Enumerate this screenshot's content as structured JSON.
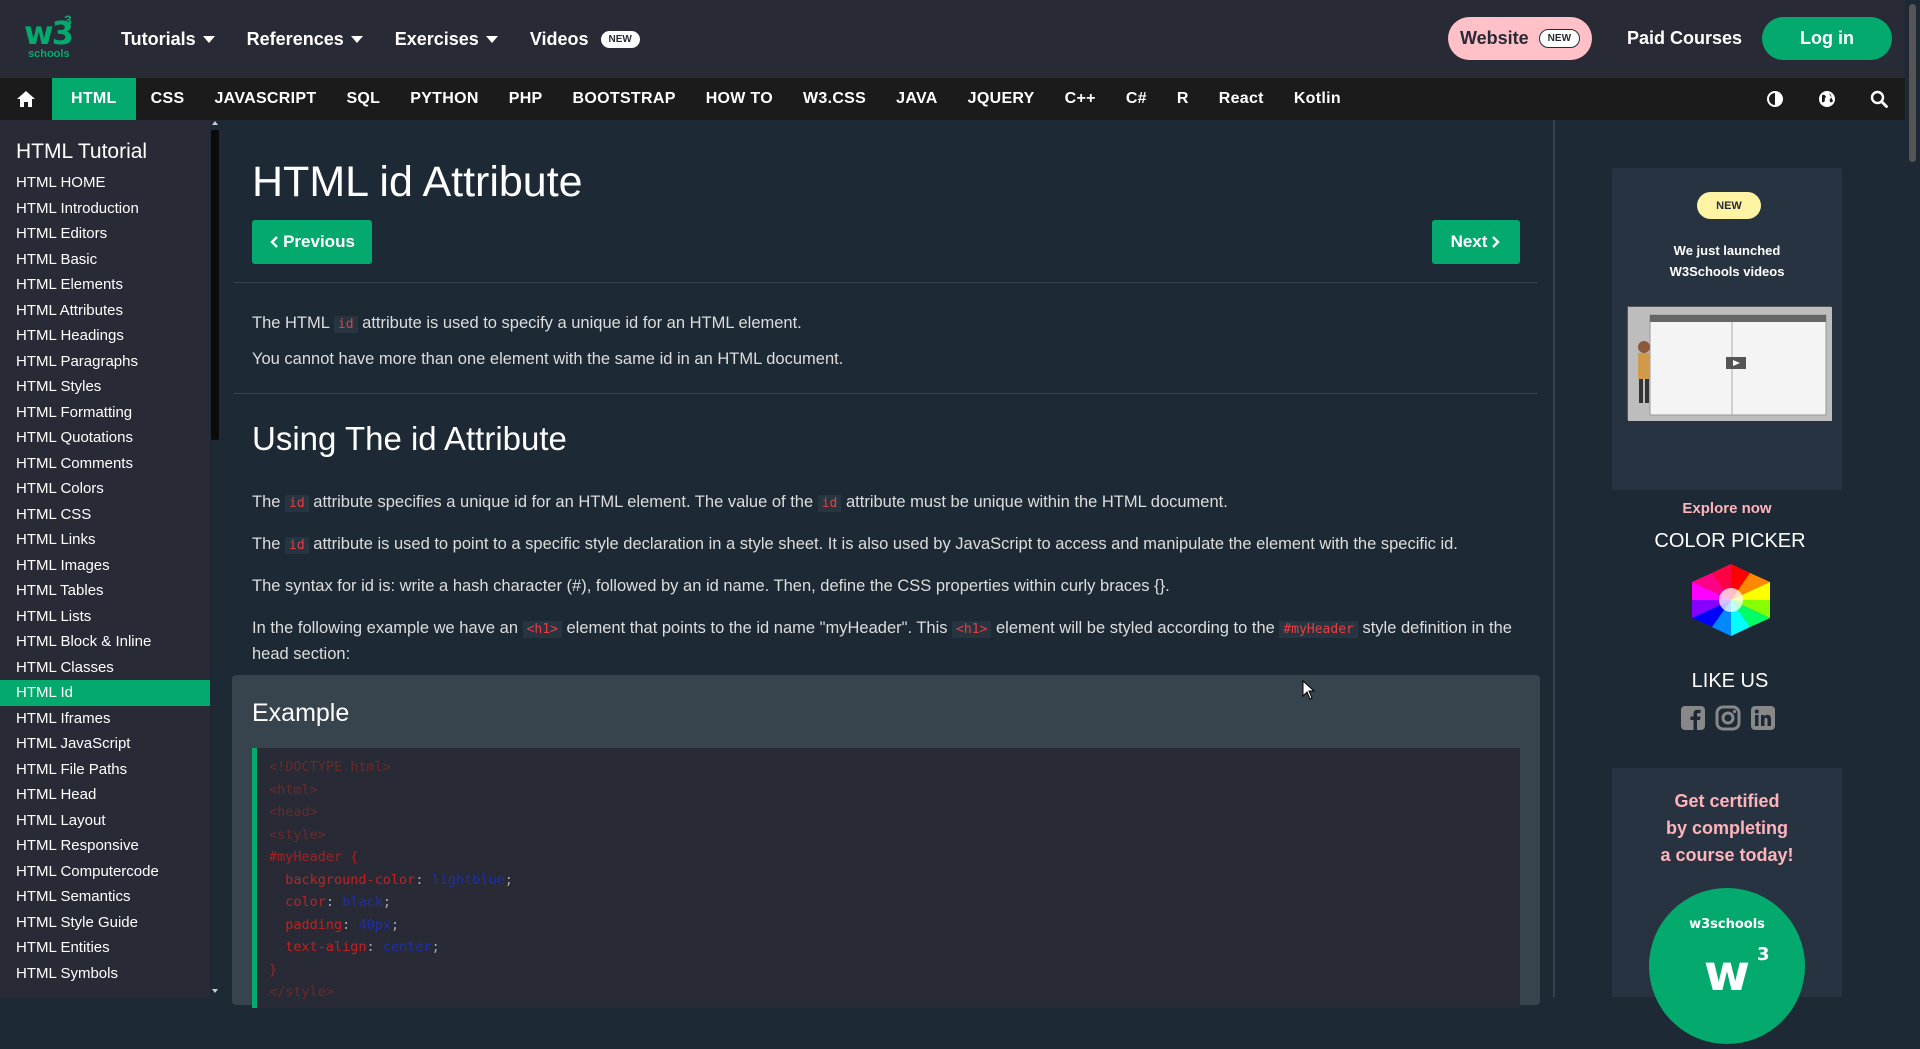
{
  "topbar": {
    "logo_text": "w3",
    "logo_sup": "3",
    "logo_sub": "schools",
    "nav": [
      {
        "label": "Tutorials"
      },
      {
        "label": "References"
      },
      {
        "label": "Exercises"
      },
      {
        "label": "Videos",
        "badge": "NEW"
      }
    ],
    "website_label": "Website",
    "website_badge": "NEW",
    "paid_courses": "Paid Courses",
    "login": "Log in"
  },
  "subnav": {
    "tabs": [
      "HTML",
      "CSS",
      "JAVASCRIPT",
      "SQL",
      "PYTHON",
      "PHP",
      "BOOTSTRAP",
      "HOW TO",
      "W3.CSS",
      "JAVA",
      "JQUERY",
      "C++",
      "C#",
      "R",
      "React",
      "Kotlin"
    ],
    "active": "HTML"
  },
  "sidebar": {
    "title": "HTML Tutorial",
    "items": [
      "HTML HOME",
      "HTML Introduction",
      "HTML Editors",
      "HTML Basic",
      "HTML Elements",
      "HTML Attributes",
      "HTML Headings",
      "HTML Paragraphs",
      "HTML Styles",
      "HTML Formatting",
      "HTML Quotations",
      "HTML Comments",
      "HTML Colors",
      "HTML CSS",
      "HTML Links",
      "HTML Images",
      "HTML Tables",
      "HTML Lists",
      "HTML Block & Inline",
      "HTML Classes",
      "HTML Id",
      "HTML Iframes",
      "HTML JavaScript",
      "HTML File Paths",
      "HTML Head",
      "HTML Layout",
      "HTML Responsive",
      "HTML Computercode",
      "HTML Semantics",
      "HTML Style Guide",
      "HTML Entities",
      "HTML Symbols"
    ],
    "active": "HTML Id"
  },
  "main": {
    "title": "HTML id Attribute",
    "prev": "Previous",
    "next": "Next",
    "intro1_a": "The HTML ",
    "intro1_code": "id",
    "intro1_b": " attribute is used to specify a unique id for an HTML element.",
    "intro2": "You cannot have more than one element with the same id in an HTML document.",
    "section_title": "Using The id Attribute",
    "p1_a": "The ",
    "p1_code1": "id",
    "p1_b": " attribute specifies a unique id for an HTML element. The value of the ",
    "p1_code2": "id",
    "p1_c": " attribute must be unique within the HTML document.",
    "p2_a": "The ",
    "p2_code": "id",
    "p2_b": " attribute is used to point to a specific style declaration in a style sheet. It is also used by JavaScript to access and manipulate the element with the specific id.",
    "p3": "The syntax for id is: write a hash character (#), followed by an id name. Then, define the CSS properties within curly braces {}.",
    "p4_a": "In the following example we have an ",
    "p4_code1": "<h1>",
    "p4_b": " element that points to the id name \"myHeader\". This ",
    "p4_code2": "<h1>",
    "p4_c": " element will be styled according to the ",
    "p4_code3": "#myHeader",
    "p4_d": " style definition in the head section:",
    "example_title": "Example",
    "code": {
      "l1": "<!DOCTYPE html>",
      "l2": "<html>",
      "l3": "<head>",
      "l4": "<style>",
      "l5": "#myHeader {",
      "l6_prop": "background-color",
      "l6_val": "lightblue",
      "l7_prop": "color",
      "l7_val": "black",
      "l8_prop": "padding",
      "l8_val": "40px",
      "l9_prop": "text-align",
      "l9_val": "center",
      "l10": "}",
      "l11": "</style>"
    }
  },
  "right": {
    "new_badge": "NEW",
    "promo_line1": "We just launched",
    "promo_line2": "W3Schools videos",
    "explore": "Explore now",
    "color_picker": "COLOR PICKER",
    "like_us": "LIKE US",
    "cert_line1": "Get certified",
    "cert_line2": "by completing",
    "cert_line3": "a course today!"
  },
  "colors": {
    "accent": "#04aa6d",
    "bg": "#1d2a35",
    "topbar": "#282a35",
    "pink": "#ffc0c7"
  }
}
